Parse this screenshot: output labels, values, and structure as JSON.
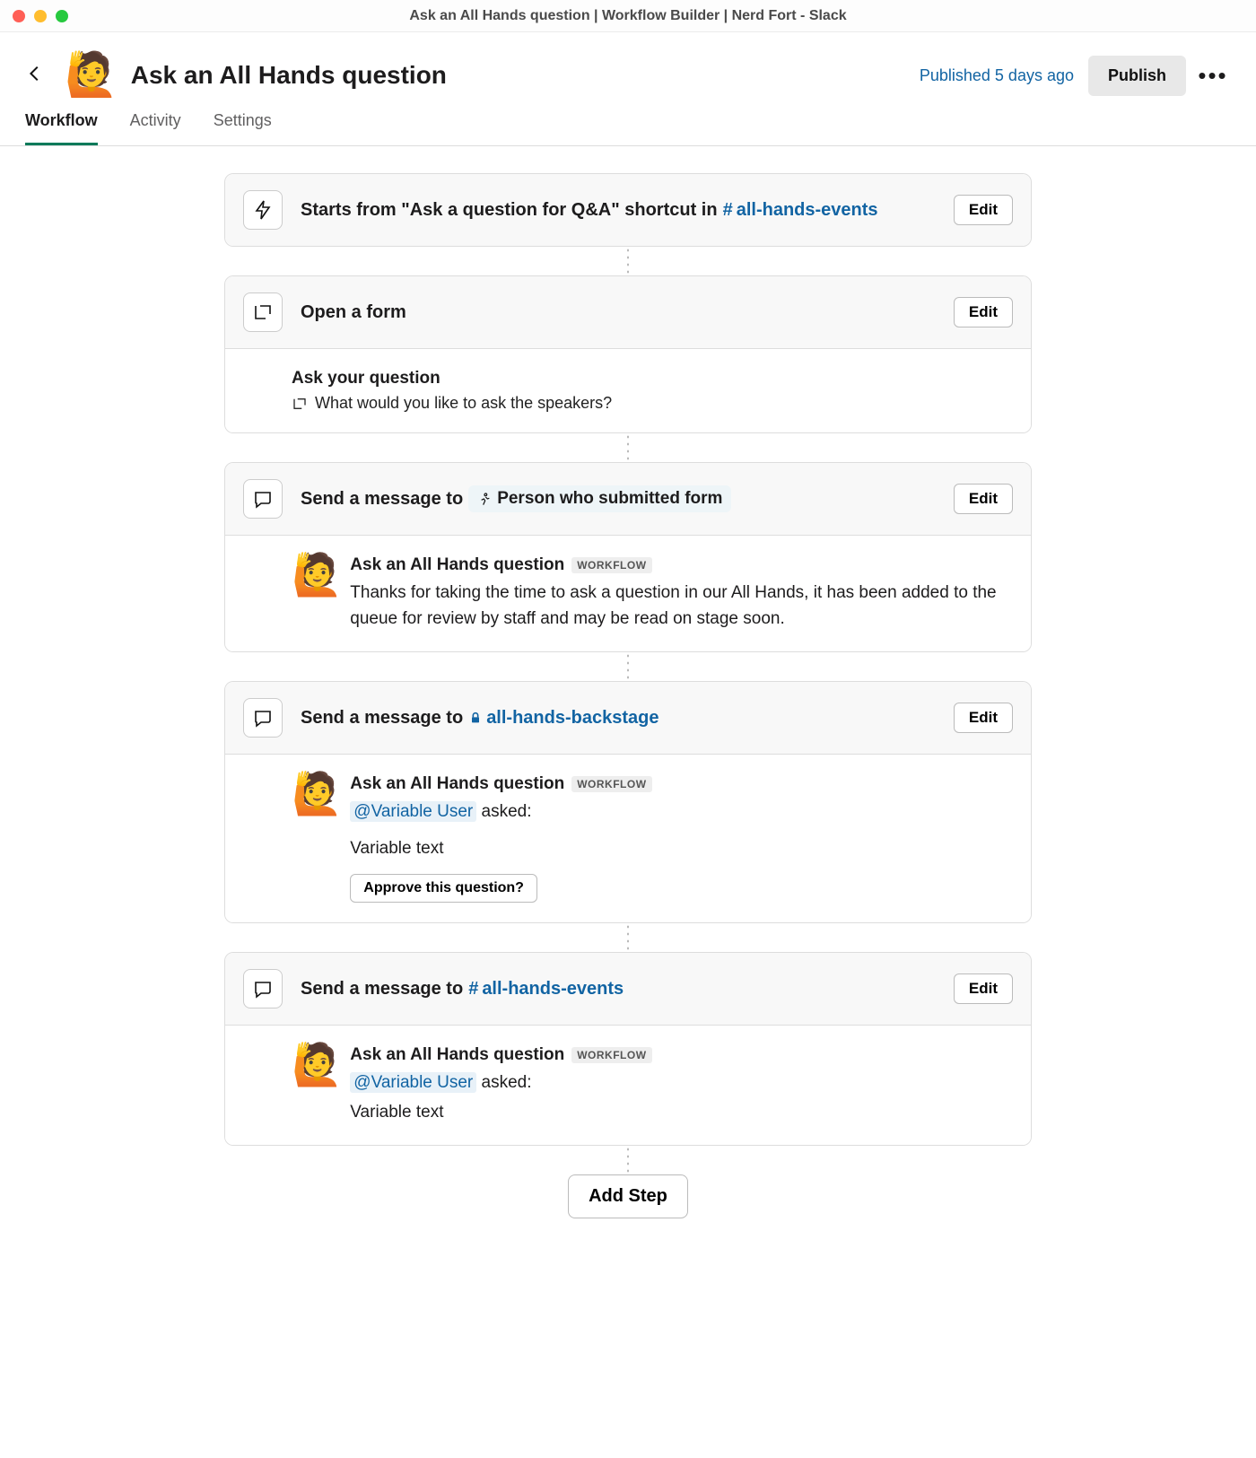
{
  "window": {
    "title": "Ask an All Hands question | Workflow Builder | Nerd Fort - Slack"
  },
  "header": {
    "emoji": "🙋",
    "title": "Ask an All Hands question",
    "published_text": "Published 5 days ago",
    "publish_button": "Publish",
    "more_label": "More actions"
  },
  "tabs": [
    {
      "label": "Workflow",
      "active": true
    },
    {
      "label": "Activity",
      "active": false
    },
    {
      "label": "Settings",
      "active": false
    }
  ],
  "steps": {
    "trigger": {
      "prefix": "Starts from \"Ask a question for Q&A\" shortcut in",
      "channel": "all-hands-events",
      "edit": "Edit"
    },
    "form": {
      "title": "Open a form",
      "edit": "Edit",
      "label": "Ask your question",
      "question": "What would you like to ask the speakers?"
    },
    "msg_submitter": {
      "title_prefix": "Send a message to",
      "pill": "Person who submitted form",
      "edit": "Edit",
      "app_name": "Ask an All Hands question",
      "app_badge": "WORKFLOW",
      "body": "Thanks for taking the time to ask a question in our All Hands, it has been added to the queue for review by staff and may be read on stage soon."
    },
    "msg_backstage": {
      "title_prefix": "Send a message to",
      "channel": "all-hands-backstage",
      "channel_private": true,
      "edit": "Edit",
      "app_name": "Ask an All Hands question",
      "app_badge": "WORKFLOW",
      "variable_user": "@Variable User",
      "asked_suffix": "asked:",
      "variable_text": "Variable text",
      "approve_button": "Approve this question?"
    },
    "msg_events": {
      "title_prefix": "Send a message to",
      "channel": "all-hands-events",
      "channel_private": false,
      "edit": "Edit",
      "app_name": "Ask an All Hands question",
      "app_badge": "WORKFLOW",
      "variable_user": "@Variable User",
      "asked_suffix": "asked:",
      "variable_text": "Variable text"
    }
  },
  "add_step": "Add Step",
  "workflow_emoji": "🙋"
}
